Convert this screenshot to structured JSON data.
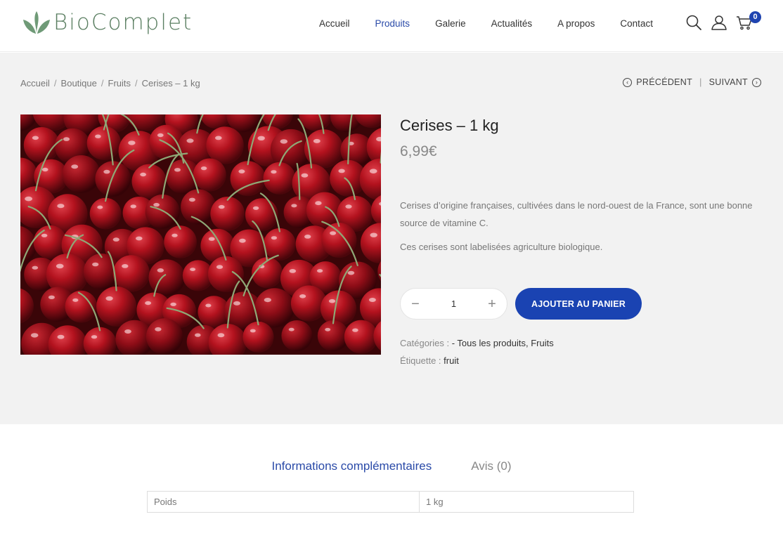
{
  "brand": {
    "name": "BioComplet",
    "leaf_color": "#6f9a77"
  },
  "nav": {
    "items": [
      {
        "label": "Accueil",
        "active": false
      },
      {
        "label": "Produits",
        "active": true
      },
      {
        "label": "Galerie",
        "active": false
      },
      {
        "label": "Actualités",
        "active": false
      },
      {
        "label": "A propos",
        "active": false
      },
      {
        "label": "Contact",
        "active": false
      }
    ]
  },
  "header_icons": {
    "search": "search-icon",
    "account": "user-icon",
    "cart": "cart-icon",
    "cart_count": "0"
  },
  "breadcrumb": {
    "items": [
      "Accueil",
      "Boutique",
      "Fruits",
      "Cerises – 1 kg"
    ],
    "separator": "/"
  },
  "pager": {
    "prev": "PRÉCÉDENT",
    "divider": "|",
    "next": "SUIVANT"
  },
  "product": {
    "title": "Cerises – 1 kg",
    "price": "6,99€",
    "description": [
      "Cerises d’origine françaises, cultivées dans le nord-ouest de la France, sont une bonne source de vitamine C.",
      "Ces cerises sont labelisées agriculture biologique."
    ],
    "quantity": "1",
    "minus": "−",
    "plus": "+",
    "add_to_cart": "AJOUTER AU PANIER",
    "categories_label": "Catégories :",
    "categories": "- Tous les produits, Fruits",
    "tag_label": "Étiquette :",
    "tag": "fruit"
  },
  "tabs": [
    {
      "label": "Informations complémentaires",
      "active": true
    },
    {
      "label": "Avis (0)",
      "active": false
    }
  ],
  "attributes": [
    {
      "name": "Poids",
      "value": "1 kg"
    }
  ],
  "colors": {
    "accent": "#1a43b2",
    "link_active": "#2a4aa8",
    "gray_bg": "#f2f2f2"
  }
}
